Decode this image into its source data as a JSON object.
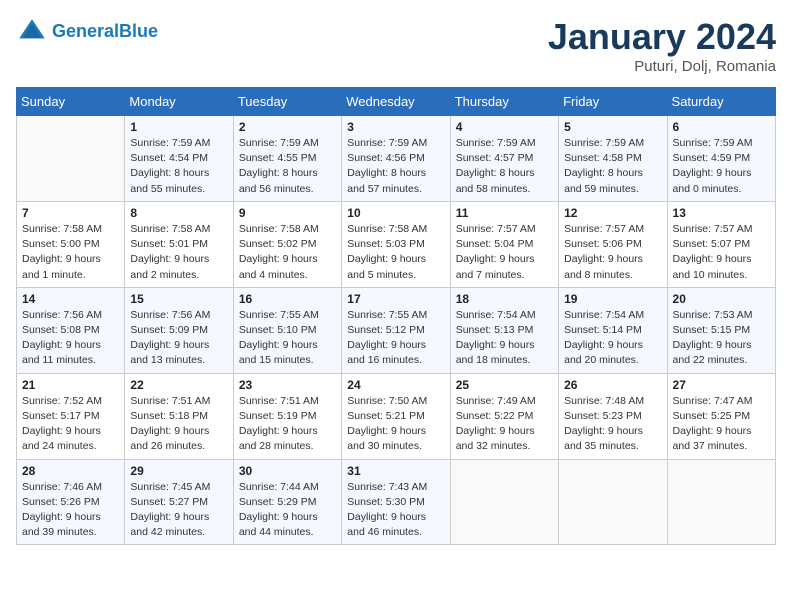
{
  "header": {
    "logo_line1": "General",
    "logo_line2": "Blue",
    "title": "January 2024",
    "subtitle": "Puturi, Dolj, Romania"
  },
  "days_of_week": [
    "Sunday",
    "Monday",
    "Tuesday",
    "Wednesday",
    "Thursday",
    "Friday",
    "Saturday"
  ],
  "weeks": [
    [
      {
        "day": "",
        "info": ""
      },
      {
        "day": "1",
        "info": "Sunrise: 7:59 AM\nSunset: 4:54 PM\nDaylight: 8 hours\nand 55 minutes."
      },
      {
        "day": "2",
        "info": "Sunrise: 7:59 AM\nSunset: 4:55 PM\nDaylight: 8 hours\nand 56 minutes."
      },
      {
        "day": "3",
        "info": "Sunrise: 7:59 AM\nSunset: 4:56 PM\nDaylight: 8 hours\nand 57 minutes."
      },
      {
        "day": "4",
        "info": "Sunrise: 7:59 AM\nSunset: 4:57 PM\nDaylight: 8 hours\nand 58 minutes."
      },
      {
        "day": "5",
        "info": "Sunrise: 7:59 AM\nSunset: 4:58 PM\nDaylight: 8 hours\nand 59 minutes."
      },
      {
        "day": "6",
        "info": "Sunrise: 7:59 AM\nSunset: 4:59 PM\nDaylight: 9 hours\nand 0 minutes."
      }
    ],
    [
      {
        "day": "7",
        "info": "Sunrise: 7:58 AM\nSunset: 5:00 PM\nDaylight: 9 hours\nand 1 minute."
      },
      {
        "day": "8",
        "info": "Sunrise: 7:58 AM\nSunset: 5:01 PM\nDaylight: 9 hours\nand 2 minutes."
      },
      {
        "day": "9",
        "info": "Sunrise: 7:58 AM\nSunset: 5:02 PM\nDaylight: 9 hours\nand 4 minutes."
      },
      {
        "day": "10",
        "info": "Sunrise: 7:58 AM\nSunset: 5:03 PM\nDaylight: 9 hours\nand 5 minutes."
      },
      {
        "day": "11",
        "info": "Sunrise: 7:57 AM\nSunset: 5:04 PM\nDaylight: 9 hours\nand 7 minutes."
      },
      {
        "day": "12",
        "info": "Sunrise: 7:57 AM\nSunset: 5:06 PM\nDaylight: 9 hours\nand 8 minutes."
      },
      {
        "day": "13",
        "info": "Sunrise: 7:57 AM\nSunset: 5:07 PM\nDaylight: 9 hours\nand 10 minutes."
      }
    ],
    [
      {
        "day": "14",
        "info": "Sunrise: 7:56 AM\nSunset: 5:08 PM\nDaylight: 9 hours\nand 11 minutes."
      },
      {
        "day": "15",
        "info": "Sunrise: 7:56 AM\nSunset: 5:09 PM\nDaylight: 9 hours\nand 13 minutes."
      },
      {
        "day": "16",
        "info": "Sunrise: 7:55 AM\nSunset: 5:10 PM\nDaylight: 9 hours\nand 15 minutes."
      },
      {
        "day": "17",
        "info": "Sunrise: 7:55 AM\nSunset: 5:12 PM\nDaylight: 9 hours\nand 16 minutes."
      },
      {
        "day": "18",
        "info": "Sunrise: 7:54 AM\nSunset: 5:13 PM\nDaylight: 9 hours\nand 18 minutes."
      },
      {
        "day": "19",
        "info": "Sunrise: 7:54 AM\nSunset: 5:14 PM\nDaylight: 9 hours\nand 20 minutes."
      },
      {
        "day": "20",
        "info": "Sunrise: 7:53 AM\nSunset: 5:15 PM\nDaylight: 9 hours\nand 22 minutes."
      }
    ],
    [
      {
        "day": "21",
        "info": "Sunrise: 7:52 AM\nSunset: 5:17 PM\nDaylight: 9 hours\nand 24 minutes."
      },
      {
        "day": "22",
        "info": "Sunrise: 7:51 AM\nSunset: 5:18 PM\nDaylight: 9 hours\nand 26 minutes."
      },
      {
        "day": "23",
        "info": "Sunrise: 7:51 AM\nSunset: 5:19 PM\nDaylight: 9 hours\nand 28 minutes."
      },
      {
        "day": "24",
        "info": "Sunrise: 7:50 AM\nSunset: 5:21 PM\nDaylight: 9 hours\nand 30 minutes."
      },
      {
        "day": "25",
        "info": "Sunrise: 7:49 AM\nSunset: 5:22 PM\nDaylight: 9 hours\nand 32 minutes."
      },
      {
        "day": "26",
        "info": "Sunrise: 7:48 AM\nSunset: 5:23 PM\nDaylight: 9 hours\nand 35 minutes."
      },
      {
        "day": "27",
        "info": "Sunrise: 7:47 AM\nSunset: 5:25 PM\nDaylight: 9 hours\nand 37 minutes."
      }
    ],
    [
      {
        "day": "28",
        "info": "Sunrise: 7:46 AM\nSunset: 5:26 PM\nDaylight: 9 hours\nand 39 minutes."
      },
      {
        "day": "29",
        "info": "Sunrise: 7:45 AM\nSunset: 5:27 PM\nDaylight: 9 hours\nand 42 minutes."
      },
      {
        "day": "30",
        "info": "Sunrise: 7:44 AM\nSunset: 5:29 PM\nDaylight: 9 hours\nand 44 minutes."
      },
      {
        "day": "31",
        "info": "Sunrise: 7:43 AM\nSunset: 5:30 PM\nDaylight: 9 hours\nand 46 minutes."
      },
      {
        "day": "",
        "info": ""
      },
      {
        "day": "",
        "info": ""
      },
      {
        "day": "",
        "info": ""
      }
    ]
  ]
}
